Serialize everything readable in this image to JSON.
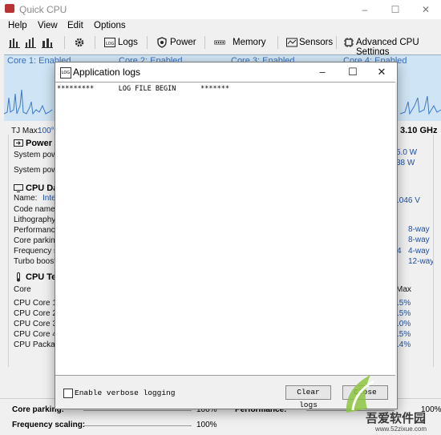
{
  "app": {
    "title": "Quick CPU",
    "window_controls": [
      "–",
      "☐",
      "✕"
    ]
  },
  "menu": [
    "Help",
    "View",
    "Edit",
    "Options"
  ],
  "toolbar": {
    "logs": "Logs",
    "power": "Power",
    "memory": "Memory",
    "sensors": "Sensors",
    "settings": "Advanced CPU Settings"
  },
  "cores": [
    "Core 1: Enabled",
    "Core 2: Enabled",
    "Core 3: Enabled",
    "Core 4: Enabled"
  ],
  "left_panel": {
    "tj_max": "TJ Max:",
    "tj_val": "100°C",
    "freq": "3.10 GHz",
    "power_header": "Power D",
    "power_rows": [
      "System power",
      "System power"
    ],
    "power_vals": [
      "5.0 W",
      "38 W"
    ],
    "cpu_header": "CPU Da",
    "cpu_rows": [
      "Name:",
      "Code name:",
      "Lithography:",
      "Performance c",
      "Core parking i",
      "Frequency sc",
      "Turbo boost in"
    ],
    "name_val": "Inte",
    "voltage": ".046 V",
    "way_vals": [
      "8-way",
      "8-way",
      "4-way",
      "12-way"
    ],
    "freq_digit": "4",
    "temp_header": "CPU Te",
    "temp_col": "Core",
    "max_col": "Max",
    "temp_rows": [
      "CPU Core 1:",
      "CPU Core 2:",
      "CPU Core 3:",
      "CPU Core 4:",
      "CPU Package"
    ],
    "temp_vals": [
      ".5%",
      ".5%",
      ".0%",
      ".5%",
      ".4%"
    ]
  },
  "bottom": {
    "core_parking": "Core parking:",
    "core_parking_val": "100%",
    "freq_scaling": "Frequency scaling:",
    "freq_scaling_val": "100%",
    "performance": "Performance:",
    "performance_val": "100%"
  },
  "dialog": {
    "title": "Application logs",
    "log_line": "*********      LOG FILE BEGIN      *******",
    "verbose_label": "Enable verbose logging",
    "clear_button": "Clear logs",
    "close_button": "Close"
  },
  "watermark": {
    "brand": "吾爱软件园",
    "url": "www.52zixue.com"
  }
}
